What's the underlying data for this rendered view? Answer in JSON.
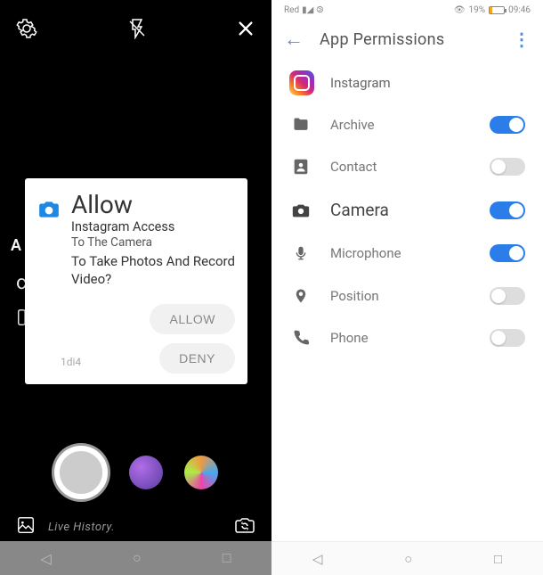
{
  "left": {
    "sideLabel": "A",
    "bottomLabel": "Live History.",
    "dialog": {
      "title": "Allow",
      "line1": "Instagram Access",
      "line2": "To The Camera",
      "line3": "To Take Photos And Record Video?",
      "allow": "ALLOW",
      "deny": "DENY",
      "counter": "1di4"
    }
  },
  "right": {
    "status": {
      "carrier": "Red",
      "battery": "19%",
      "time": "09:46"
    },
    "headerTitle": "App Permissions",
    "appName": "Instagram",
    "perms": {
      "archive": "Archive",
      "contact": "Contact",
      "camera": "Camera",
      "microphone": "Microphone",
      "position": "Position",
      "phone": "Phone"
    }
  }
}
